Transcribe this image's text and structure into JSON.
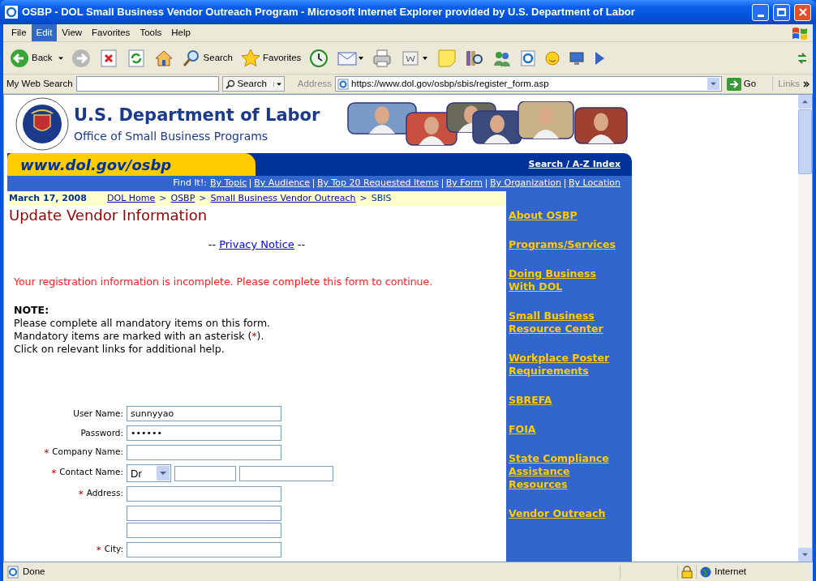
{
  "window": {
    "title": "OSBP - DOL Small Business Vendor Outreach Program - Microsoft Internet Explorer provided by U.S. Department of Labor"
  },
  "menu": [
    {
      "label": "File",
      "selected": false
    },
    {
      "label": "Edit",
      "selected": true
    },
    {
      "label": "View",
      "selected": false
    },
    {
      "label": "Favorites",
      "selected": false
    },
    {
      "label": "Tools",
      "selected": false
    },
    {
      "label": "Help",
      "selected": false
    }
  ],
  "toolbar": [
    {
      "kind": "back",
      "label": "Back"
    },
    {
      "kind": "forward"
    },
    {
      "kind": "stop"
    },
    {
      "kind": "refresh"
    },
    {
      "kind": "home"
    },
    {
      "kind": "search",
      "label": "Search"
    },
    {
      "kind": "favorites",
      "label": "Favorites"
    },
    {
      "kind": "history"
    },
    {
      "kind": "mail"
    },
    {
      "kind": "print"
    },
    {
      "kind": "edit"
    },
    {
      "kind": "note"
    },
    {
      "kind": "research"
    },
    {
      "kind": "messenger"
    },
    {
      "kind": "ie"
    },
    {
      "kind": "smiley"
    },
    {
      "kind": "monitor"
    },
    {
      "kind": "cursor"
    }
  ],
  "address_bar": {
    "web_search_label": "My Web Search",
    "search_button": "Search",
    "address_label": "Address",
    "url": "https://www.dol.gov/osbp/sbis/register_form.asp",
    "go": "Go",
    "links": "Links"
  },
  "header": {
    "title": "U.S. Department of Labor",
    "subtitle": "Office of Small Business Programs",
    "site": "www.dol.gov/osbp",
    "search_link": "Search / A-Z Index",
    "find_it": "Find It!:",
    "find_links": [
      "By Topic",
      "By Audience",
      "By Top 20 Requested Items",
      "By Form",
      "By Organization",
      "By Location"
    ]
  },
  "breadcrumb": {
    "date": "March 17, 2008",
    "links": [
      "DOL Home",
      "OSBP",
      "Small Business Vendor Outreach"
    ],
    "separators": [
      ">",
      ">",
      ">"
    ],
    "current": "SBIS"
  },
  "heading": "Update Vendor Information",
  "privacy": {
    "before": "--",
    "link": "Privacy Notice",
    "after": "--"
  },
  "error": "Your registration information is incomplete. Please complete this form to continue.",
  "note": {
    "title": "NOTE:",
    "line_1": "Please complete all mandatory items on this form.",
    "line_2_before": "Mandatory items are marked with an asterisk (",
    "line_2_mark": "*",
    "line_2_after": ").",
    "line_3": "Click on relevant links for additional help."
  },
  "form": [
    {
      "label": "User Name:",
      "required": false,
      "kind": "text",
      "value": "sunnyyao"
    },
    {
      "label": "Password:",
      "required": false,
      "kind": "password",
      "value": "••••••"
    },
    {
      "label": "Company Name:",
      "required": true,
      "kind": "text"
    },
    {
      "label": "Contact Name:",
      "required": true,
      "kind": "name",
      "value": "Dr"
    },
    {
      "label": "Address:",
      "required": true,
      "kind": "text"
    },
    {
      "kind": "text",
      "required": false
    },
    {
      "kind": "text",
      "required": false
    },
    {
      "label": "City:",
      "required": true,
      "kind": "text"
    }
  ],
  "required_mark": "*",
  "sidebar": [
    [
      "About OSBP"
    ],
    [
      "Programs/Services"
    ],
    [
      "Doing Business",
      "With DOL"
    ],
    [
      "Small Business",
      "Resource Center"
    ],
    [
      "Workplace Poster",
      "Requirements"
    ],
    [
      "SBREFA"
    ],
    [
      "FOIA"
    ],
    [
      "State Compliance",
      "Assistance",
      "Resources"
    ],
    [
      "Vendor Outreach"
    ]
  ],
  "status_bar": {
    "text": "Done",
    "zone": "Internet"
  }
}
